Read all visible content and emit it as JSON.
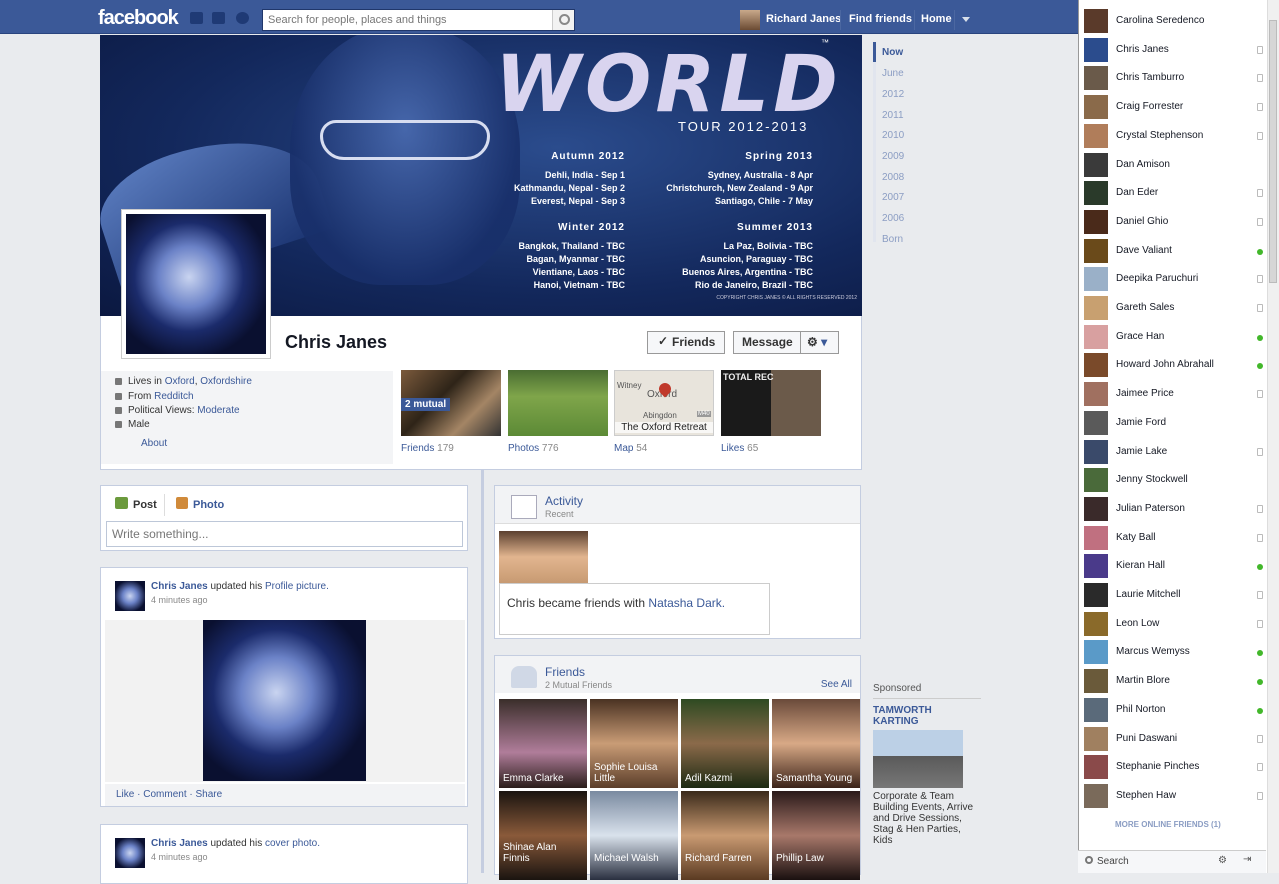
{
  "topbar": {
    "logo": "facebook",
    "search_placeholder": "Search for people, places and things",
    "user": "Richard Janes",
    "find_friends": "Find friends",
    "home": "Home"
  },
  "cover": {
    "title": "WORLD",
    "tm": "™",
    "subtitle": "TOUR 2012-2013",
    "autumn": {
      "title": "Autumn 2012",
      "lines": [
        "Dehli, India - Sep 1",
        "Kathmandu, Nepal - Sep 2",
        "Everest, Nepal - Sep 3"
      ]
    },
    "spring": {
      "title": "Spring 2013",
      "lines": [
        "Sydney, Australia - 8 Apr",
        "Christchurch, New Zealand - 9 Apr",
        "Santiago, Chile - 7 May"
      ]
    },
    "winter": {
      "title": "Winter 2012",
      "lines": [
        "Bangkok, Thailand - TBC",
        "Bagan, Myanmar - TBC",
        "Vientiane, Laos - TBC",
        "Hanoi, Vietnam - TBC"
      ]
    },
    "summer": {
      "title": "Summer 2013",
      "lines": [
        "La Paz, Bolivia - TBC",
        "Asuncion, Paraguay - TBC",
        "Buenos Aires, Argentina - TBC",
        "Rio de Janeiro, Brazil - TBC"
      ]
    },
    "copyright": "COPYRIGHT CHRIS JANES © ALL RIGHTS RESERVED 2012"
  },
  "profile": {
    "name": "Chris Janes",
    "friends_btn": "Friends",
    "message_btn": "Message",
    "lives_pre": "Lives in",
    "lives_city": "Oxford",
    "lives_region": "Oxfordshire",
    "from_pre": "From",
    "from": "Redditch",
    "political_pre": "Political Views:",
    "political": "Moderate",
    "gender": "Male",
    "about": "About"
  },
  "tiles": {
    "mutual": "2 mutual",
    "friends": "Friends",
    "friends_count": "179",
    "photos": "Photos",
    "photos_count": "776",
    "map": "Map",
    "map_count": "54",
    "map_place": "The Oxford Retreat",
    "map_town1": "Witney",
    "map_town2": "Oxford",
    "map_town3": "Abingdon",
    "map_road": "M40",
    "likes": "Likes",
    "likes_count": "65",
    "likes_poster": "TOTAL REC"
  },
  "composer": {
    "post": "Post",
    "photo": "Photo",
    "placeholder": "Write something..."
  },
  "story1": {
    "name": "Chris Janes",
    "action": "updated his",
    "object": "Profile picture.",
    "time": "4 minutes ago",
    "like": "Like",
    "comment": "Comment",
    "share": "Share"
  },
  "story2": {
    "name": "Chris Janes",
    "action": "updated his",
    "object": "cover photo.",
    "time": "4 minutes ago"
  },
  "activity": {
    "title": "Activity",
    "sub": "Recent",
    "text_pre": "Chris became friends with",
    "text_name": "Natasha Dark."
  },
  "friends_box": {
    "title": "Friends",
    "sub": "2 Mutual Friends",
    "see_all": "See All",
    "people": [
      "Emma Clarke",
      "Sophie Louisa Little",
      "Adil Kazmi",
      "Samantha Young",
      "Shinae Alan Finnis",
      "Michael Walsh",
      "Richard Farren",
      "Phillip Law"
    ]
  },
  "years": [
    "Now",
    "June",
    "2012",
    "2011",
    "2010",
    "2009",
    "2008",
    "2007",
    "2006",
    "Born"
  ],
  "sponsored": {
    "label": "Sponsored",
    "title": "TAMWORTH KARTING",
    "text": "Corporate & Team Building Events, Arrive and Drive Sessions, Stag & Hen Parties, Kids"
  },
  "chat": {
    "friends": [
      {
        "name": "Carolina Seredenco",
        "status": "none"
      },
      {
        "name": "Chris Janes",
        "status": "mobile"
      },
      {
        "name": "Chris Tamburro",
        "status": "mobile"
      },
      {
        "name": "Craig Forrester",
        "status": "mobile"
      },
      {
        "name": "Crystal Stephenson",
        "status": "mobile"
      },
      {
        "name": "Dan Amison",
        "status": "none"
      },
      {
        "name": "Dan Eder",
        "status": "mobile"
      },
      {
        "name": "Daniel Ghio",
        "status": "mobile"
      },
      {
        "name": "Dave Valiant",
        "status": "online"
      },
      {
        "name": "Deepika Paruchuri",
        "status": "mobile"
      },
      {
        "name": "Gareth Sales",
        "status": "mobile"
      },
      {
        "name": "Grace Han",
        "status": "online"
      },
      {
        "name": "Howard John Abrahall",
        "status": "online"
      },
      {
        "name": "Jaimee Price",
        "status": "mobile"
      },
      {
        "name": "Jamie Ford",
        "status": "none"
      },
      {
        "name": "Jamie Lake",
        "status": "mobile"
      },
      {
        "name": "Jenny Stockwell",
        "status": "none"
      },
      {
        "name": "Julian Paterson",
        "status": "mobile"
      },
      {
        "name": "Katy Ball",
        "status": "mobile"
      },
      {
        "name": "Kieran Hall",
        "status": "online"
      },
      {
        "name": "Laurie Mitchell",
        "status": "mobile"
      },
      {
        "name": "Leon Low",
        "status": "mobile"
      },
      {
        "name": "Marcus Wemyss",
        "status": "online"
      },
      {
        "name": "Martin Blore",
        "status": "online"
      },
      {
        "name": "Phil Norton",
        "status": "online"
      },
      {
        "name": "Puni Daswani",
        "status": "mobile"
      },
      {
        "name": "Stephanie Pinches",
        "status": "mobile"
      },
      {
        "name": "Stephen Haw",
        "status": "mobile"
      }
    ],
    "more_online": "MORE ONLINE FRIENDS (1)",
    "search": "Search"
  }
}
